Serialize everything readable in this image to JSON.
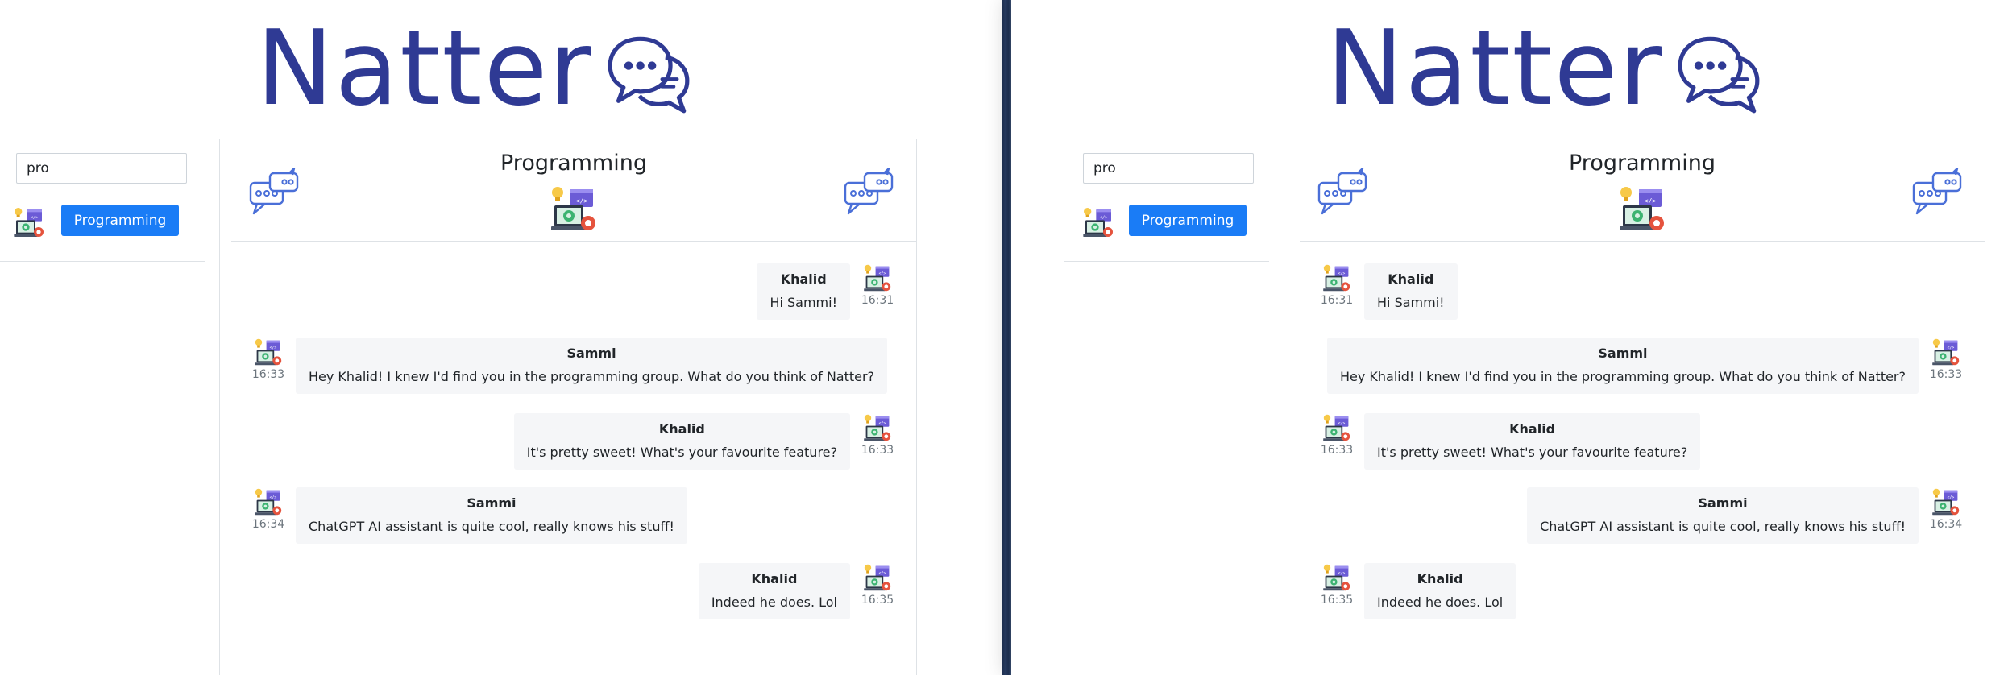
{
  "brand": {
    "name": "Natter",
    "color": "#2f3a94"
  },
  "search": {
    "value": "pro"
  },
  "groups": [
    {
      "label": "Programming"
    }
  ],
  "chat": {
    "title": "Programming"
  },
  "left_messages": [
    {
      "sender": "Khalid",
      "text": "Hi Sammi!",
      "time": "16:31",
      "side": "right"
    },
    {
      "sender": "Sammi",
      "text": "Hey Khalid! I knew I'd find you in the programming group. What do you think of Natter?",
      "time": "16:33",
      "side": "left"
    },
    {
      "sender": "Khalid",
      "text": "It's pretty sweet! What's your favourite feature?",
      "time": "16:33",
      "side": "right"
    },
    {
      "sender": "Sammi",
      "text": "ChatGPT AI assistant is quite cool, really knows his stuff!",
      "time": "16:34",
      "side": "left"
    },
    {
      "sender": "Khalid",
      "text": "Indeed he does. Lol",
      "time": "16:35",
      "side": "right"
    }
  ],
  "right_messages": [
    {
      "sender": "Khalid",
      "text": "Hi Sammi!",
      "time": "16:31",
      "side": "left"
    },
    {
      "sender": "Sammi",
      "text": "Hey Khalid! I knew I'd find you in the programming group. What do you think of Natter?",
      "time": "16:33",
      "side": "right"
    },
    {
      "sender": "Khalid",
      "text": "It's pretty sweet! What's your favourite feature?",
      "time": "16:33",
      "side": "left"
    },
    {
      "sender": "Sammi",
      "text": "ChatGPT AI assistant is quite cool, really knows his stuff!",
      "time": "16:34",
      "side": "right"
    },
    {
      "sender": "Khalid",
      "text": "Indeed he does. Lol",
      "time": "16:35",
      "side": "left"
    }
  ]
}
